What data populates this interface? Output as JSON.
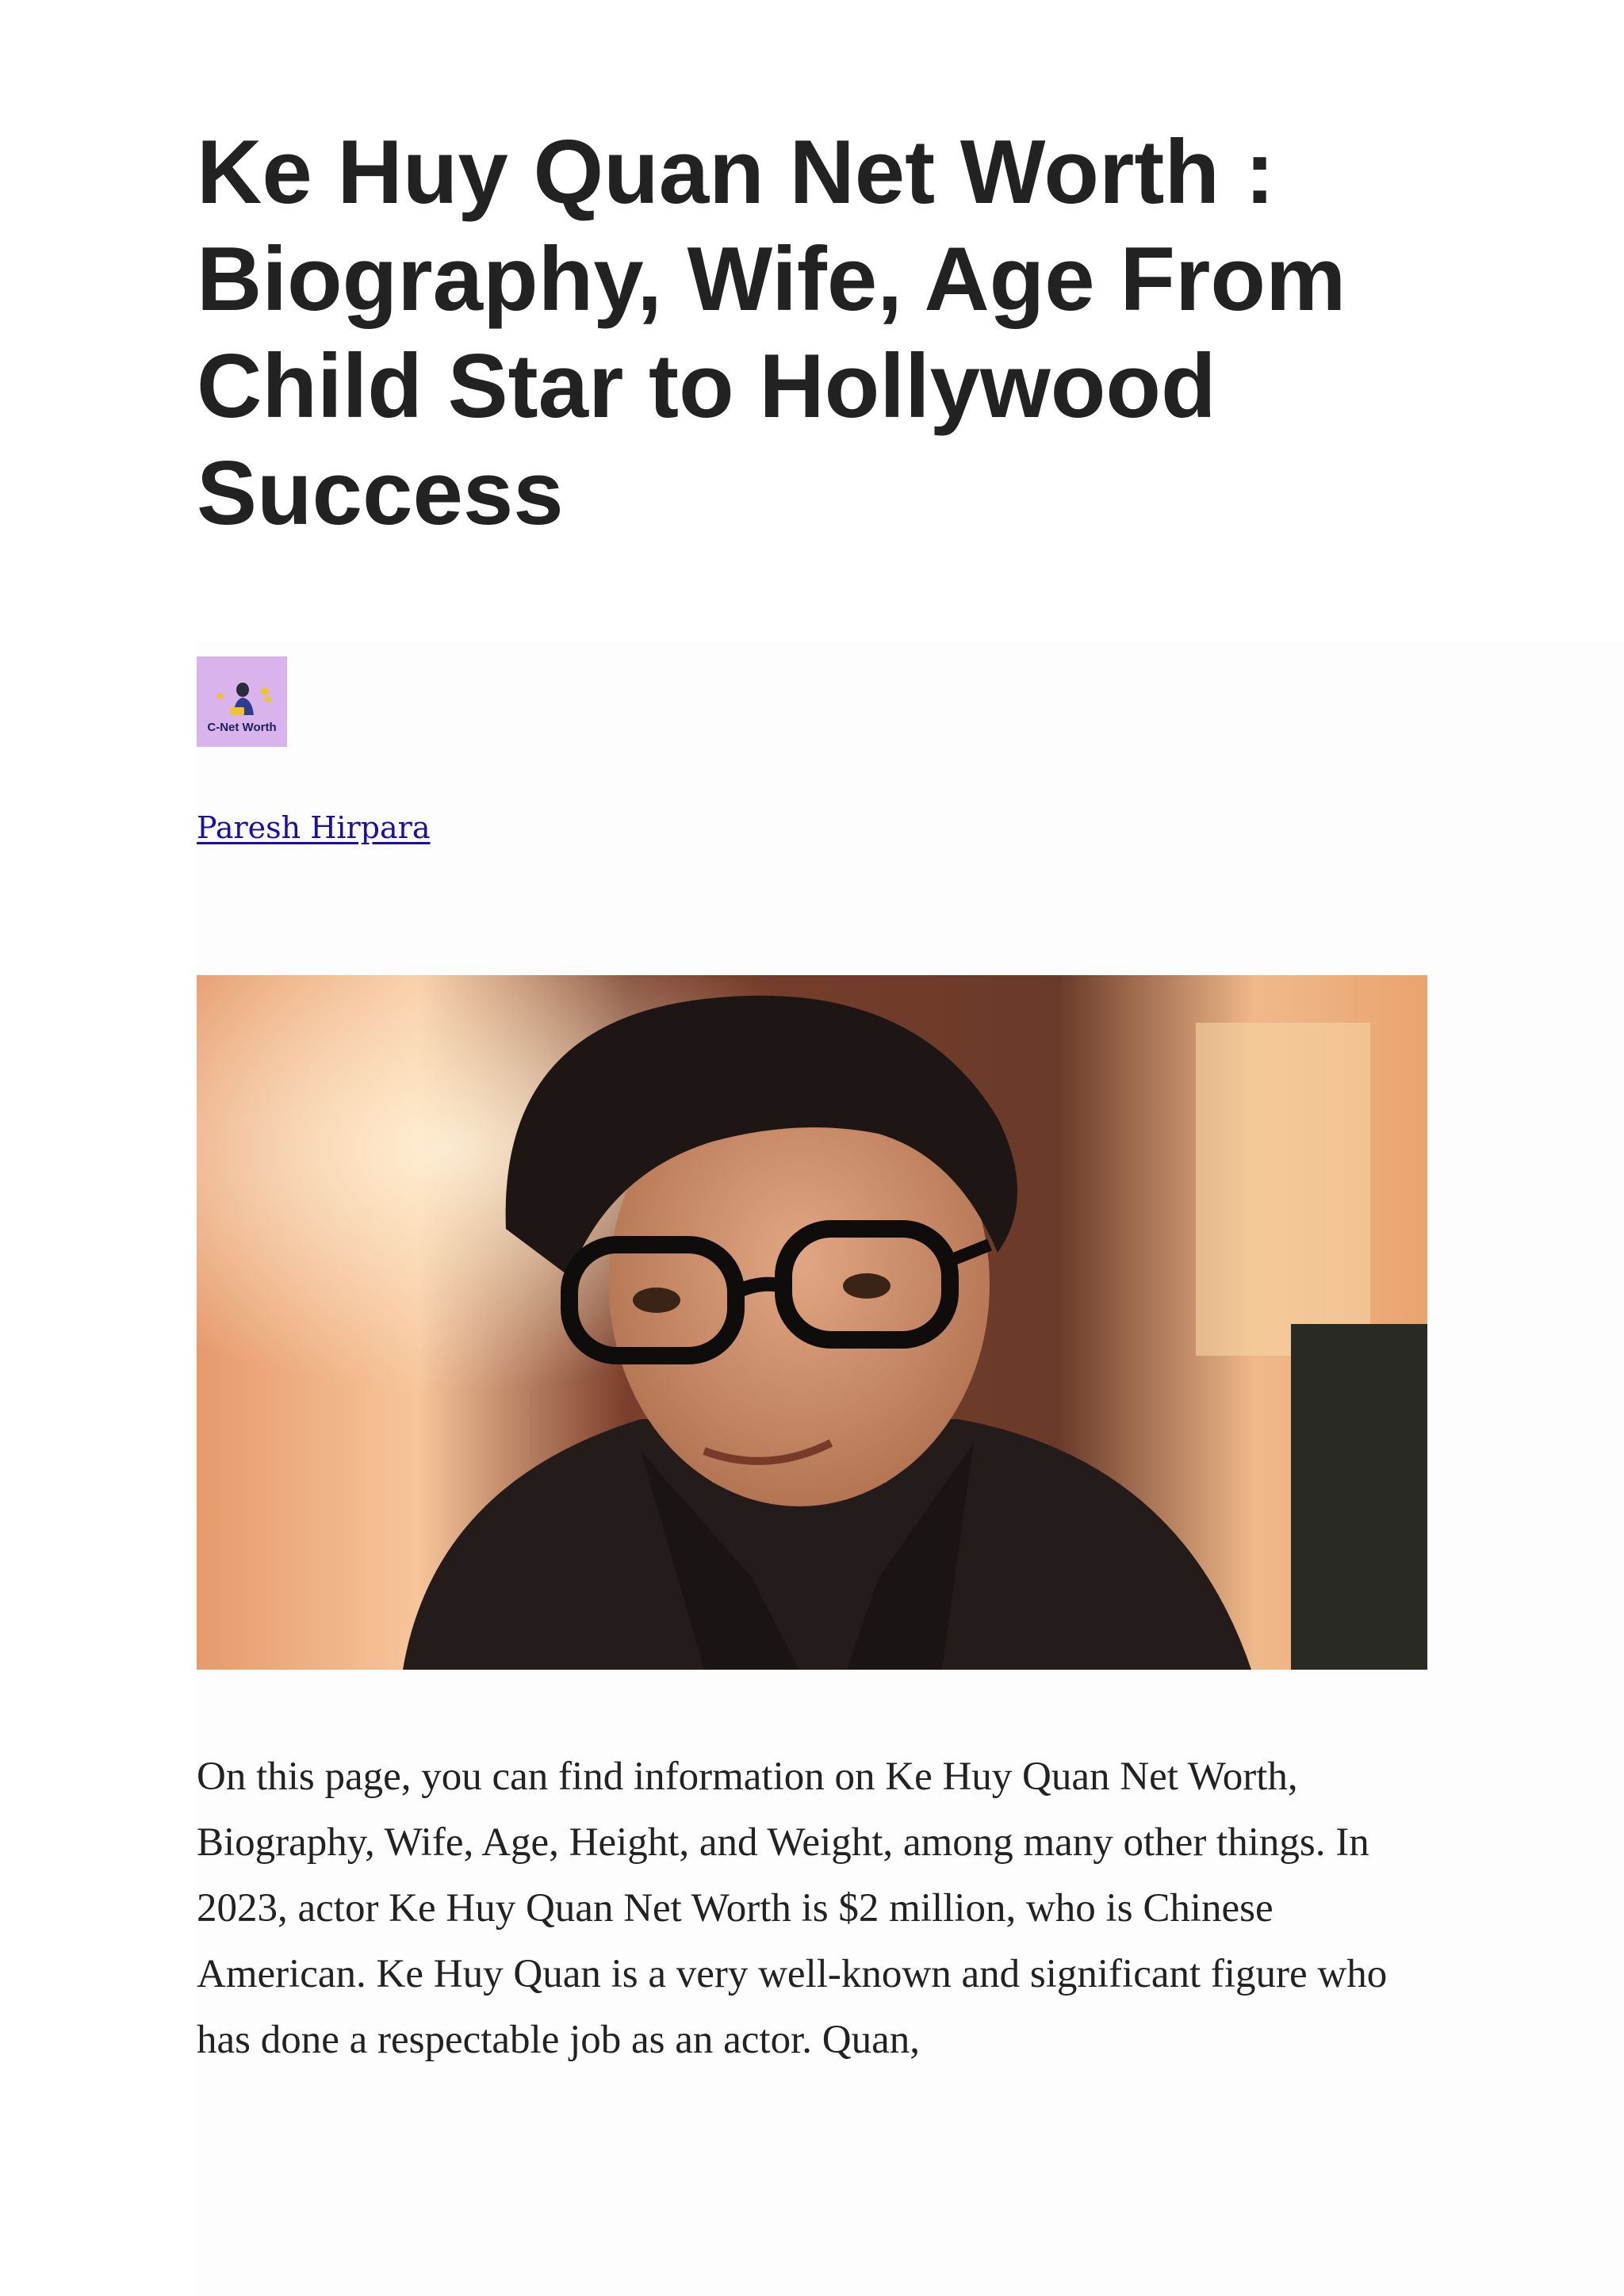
{
  "article": {
    "title": "Ke Huy Quan Net Worth : Biography, Wife, Age From Child Star to Hollywood Success",
    "logo": {
      "text": "C-Net Worth",
      "icon": "person-with-coins-icon",
      "background": "#d9b4ec"
    },
    "author": "Paresh Hirpara",
    "author_color": "#1a0dab",
    "photo": {
      "subject": "portrait-photo"
    },
    "intro": "On this page, you can find information on Ke Huy Quan Net Worth, Biography, Wife, Age, Height, and Weight, among many other things. In 2023, actor Ke Huy Quan Net Worth is $2 million, who is Chinese American. Ke Huy Quan is a very well-known and significant figure who has done a respectable job as an actor. Quan,"
  }
}
